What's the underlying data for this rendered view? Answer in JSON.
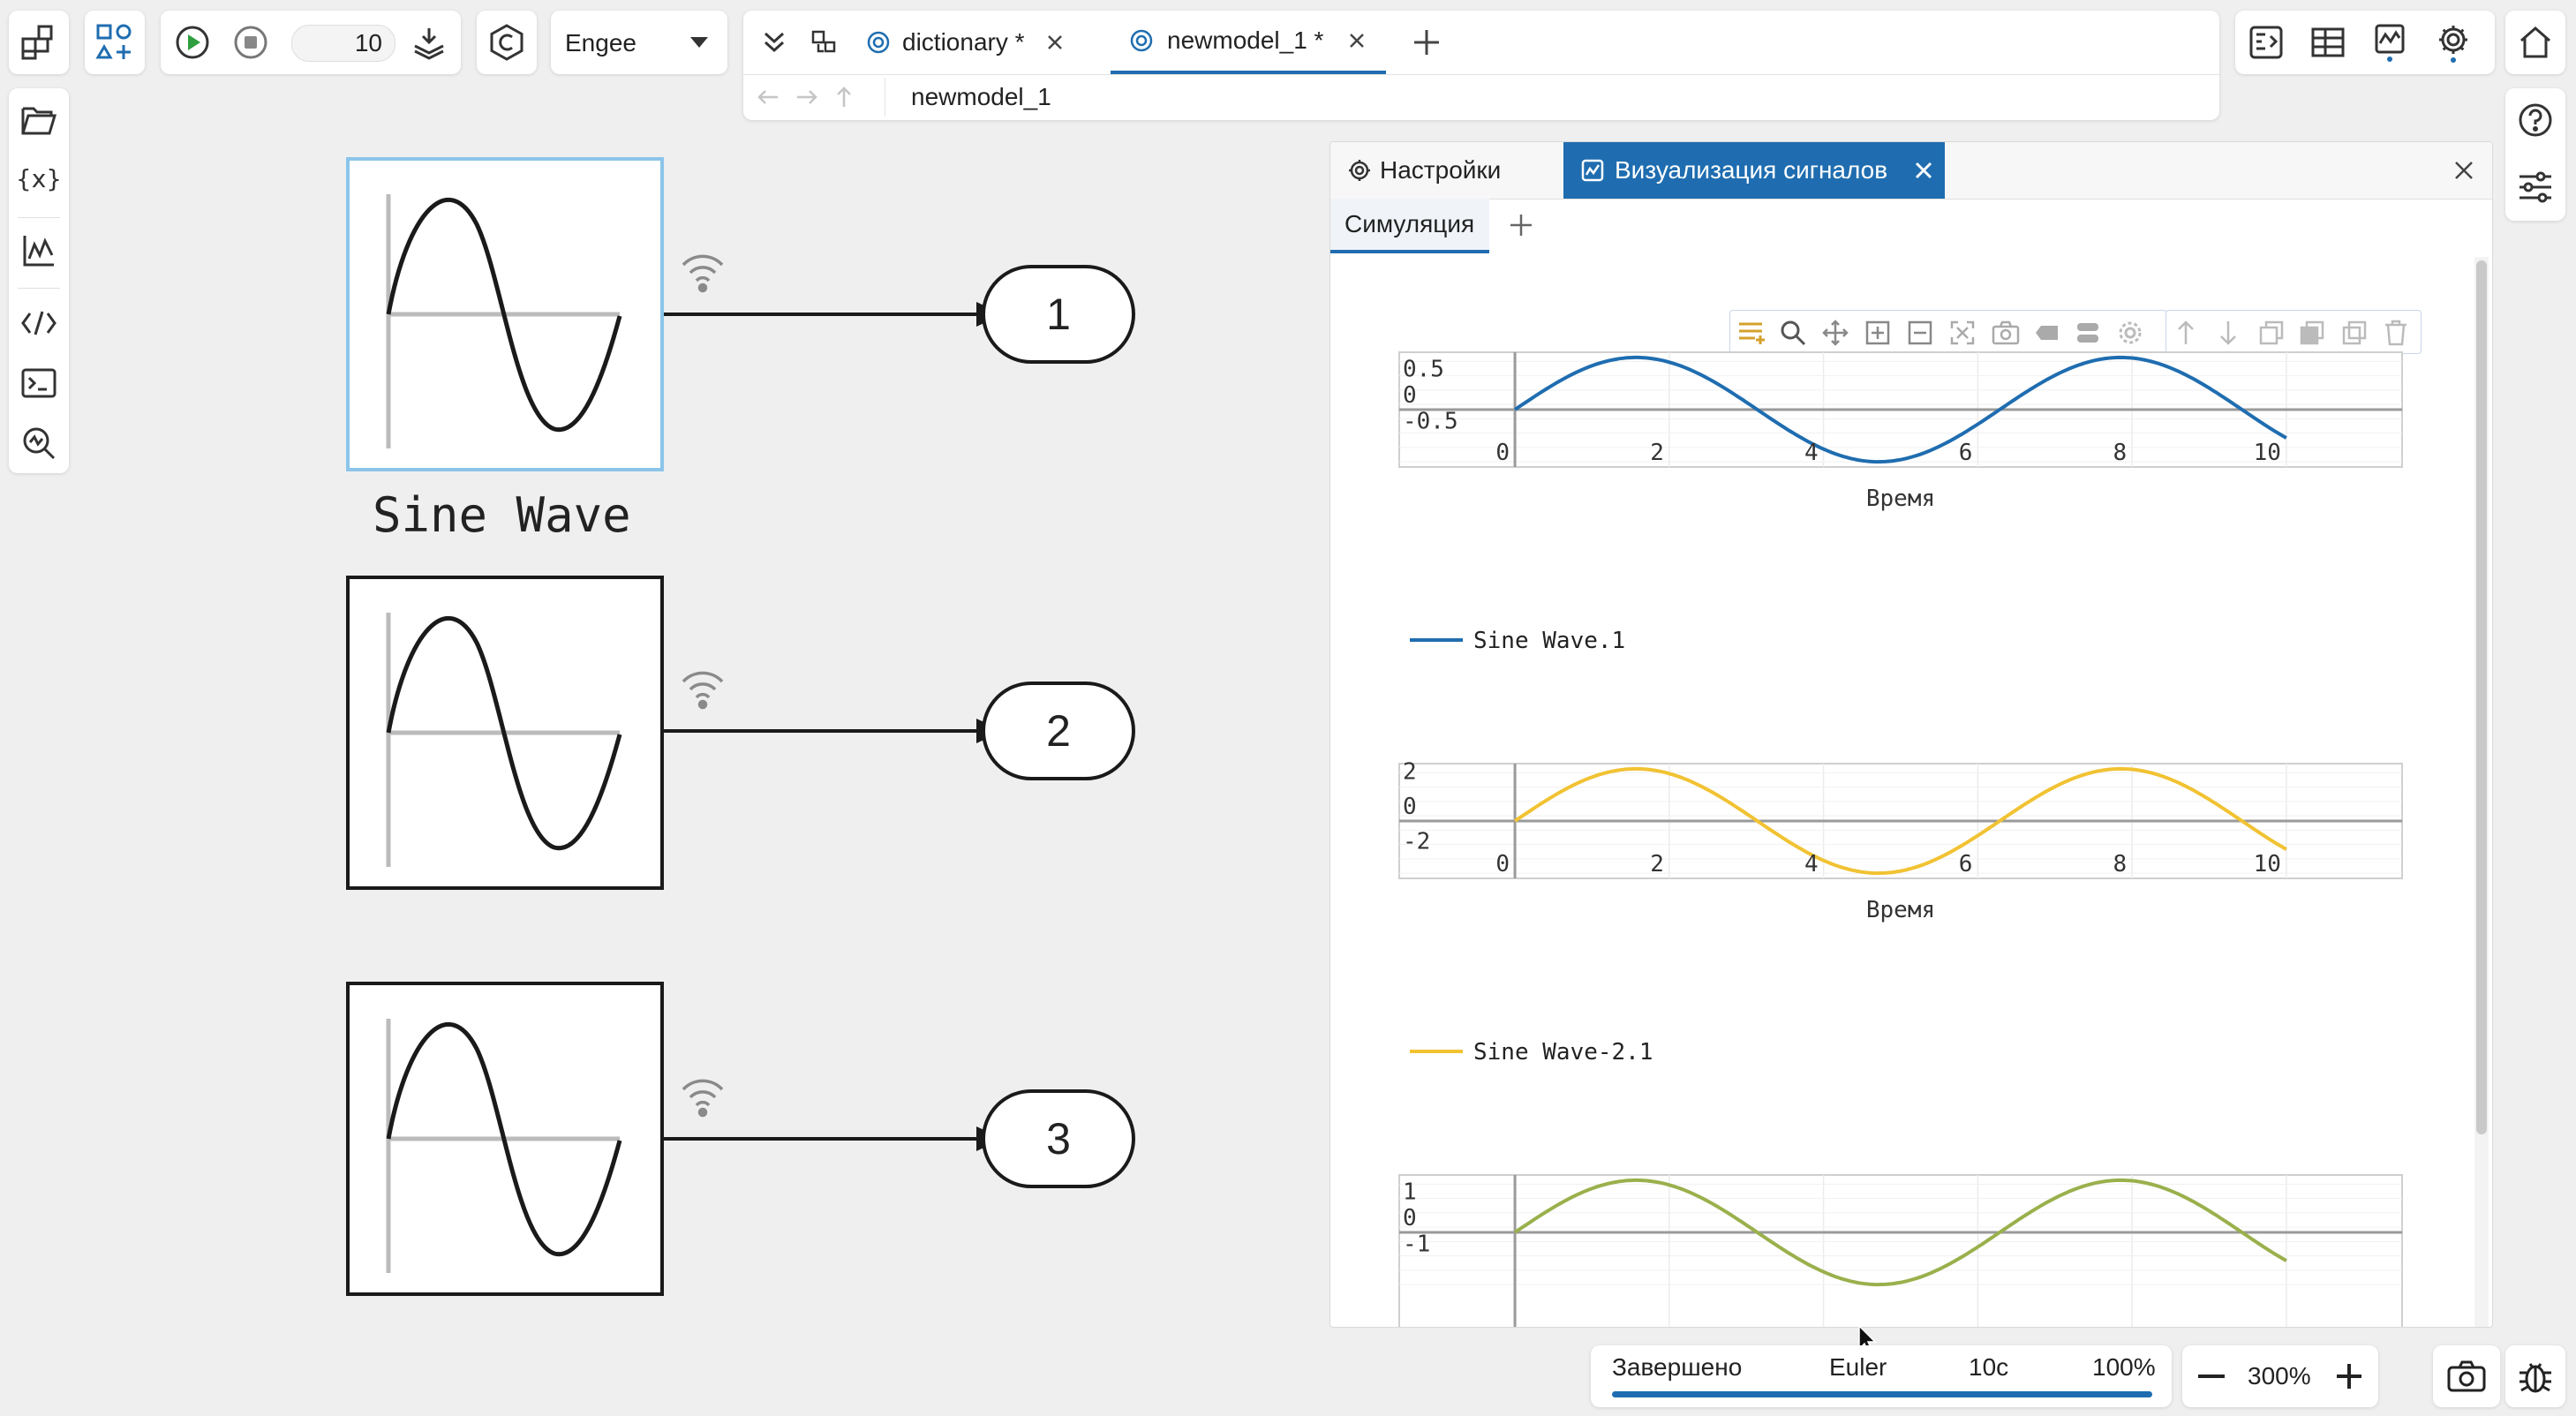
{
  "toolbar": {
    "step_value": "10",
    "engine_select": "Engee"
  },
  "tabs": [
    {
      "label": "dictionary *"
    },
    {
      "label": "newmodel_1 *"
    }
  ],
  "breadcrumb": {
    "path": "newmodel_1"
  },
  "canvas": {
    "block_label": "Sine Wave",
    "ports": [
      "1",
      "2",
      "3"
    ]
  },
  "signal_panel": {
    "tab_settings": "Настройки",
    "tab_visualization": "Визуализация сигналов",
    "subtab": "Симуляция"
  },
  "charts_meta": {
    "xlabel": "Время",
    "legend1": "Sine Wave.1",
    "legend2": "Sine Wave-2.1"
  },
  "chart_data": [
    {
      "type": "line",
      "xlabel": "Время",
      "x_ticks": [
        0,
        2,
        4,
        6,
        8,
        10
      ],
      "y_ticks": [
        0.5,
        0,
        -0.5
      ],
      "xlim": [
        -1.5,
        11.5
      ],
      "ylim": [
        -1.1,
        1.1
      ],
      "series": [
        {
          "name": "Sine Wave.1",
          "color": "#1f6db0",
          "amplitude": 1,
          "x_range": [
            0,
            10
          ],
          "function": "sin"
        }
      ]
    },
    {
      "type": "line",
      "xlabel": "Время",
      "x_ticks": [
        0,
        2,
        4,
        6,
        8,
        10
      ],
      "y_ticks": [
        2,
        0,
        -2
      ],
      "xlim": [
        -1.5,
        11.5
      ],
      "ylim": [
        -3.3,
        3.3
      ],
      "series": [
        {
          "name": "Sine Wave-2.1",
          "color": "#f1c232",
          "amplitude": 3,
          "x_range": [
            0,
            10
          ],
          "function": "sin"
        }
      ]
    },
    {
      "type": "line",
      "y_ticks": [
        1,
        0,
        -1
      ],
      "xlim": [
        -1.5,
        11.5
      ],
      "ylim": [
        -2.2,
        2.2
      ],
      "series": [
        {
          "color": "#9ab04c",
          "amplitude": 2,
          "x_range": [
            0,
            10
          ],
          "function": "sin"
        }
      ]
    }
  ],
  "status": {
    "state": "Завершено",
    "solver": "Euler",
    "time": "10с",
    "progress_label": "100%",
    "progress": 1.0,
    "zoom": "300%"
  },
  "colors": {
    "accent": "#1f6db0",
    "tab_active_bg": "#1f6db0",
    "series1": "#1f6db0",
    "series2": "#f1c232",
    "series3": "#9ab04c"
  }
}
